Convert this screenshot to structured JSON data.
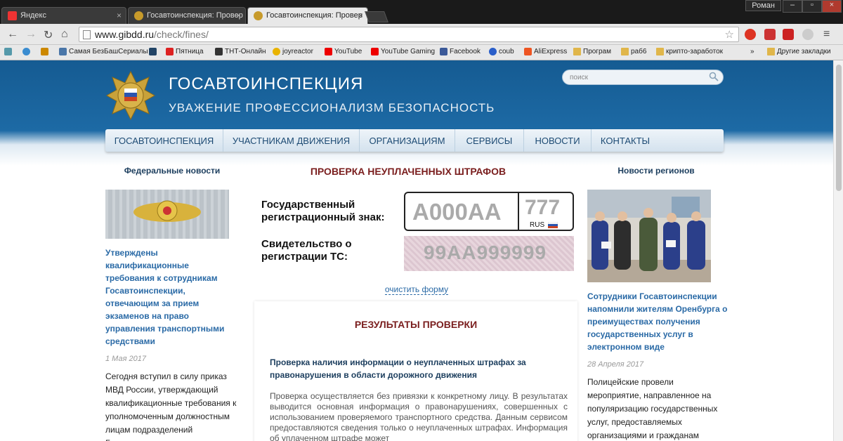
{
  "browser": {
    "tabs": [
      {
        "title": "Яндекс"
      },
      {
        "title": "Госавтоинспекция: Провер"
      },
      {
        "title": "Госавтоинспекция: Провер"
      }
    ],
    "user": "Роман",
    "url_domain": "www.gibdd.ru",
    "url_path": "/check/fines/",
    "bookmarks": [
      {
        "label": "Самая БезБашСериалы"
      },
      {
        "label": "Пятница"
      },
      {
        "label": "ТНТ-Онлайн"
      },
      {
        "label": "joyreactor"
      },
      {
        "label": "YouTube"
      },
      {
        "label": "YouTube Gaming"
      },
      {
        "label": "Facebook"
      },
      {
        "label": "coub"
      },
      {
        "label": "AliExpress"
      },
      {
        "label": "Програм"
      },
      {
        "label": "раб6"
      },
      {
        "label": "крипто-заработок"
      },
      {
        "label": "Другие закладки"
      }
    ],
    "overflow": "»"
  },
  "site": {
    "title": "ГОСАВТОИНСПЕКЦИЯ",
    "motto": "УВАЖЕНИЕ  ПРОФЕССИОНАЛИЗМ  БЕЗОПАСНОСТЬ",
    "search_placeholder": "поиск",
    "nav": [
      "ГОСАВТОИНСПЕКЦИЯ",
      "УЧАСТНИКАМ ДВИЖЕНИЯ",
      "ОРГАНИЗАЦИЯМ",
      "СЕРВИСЫ",
      "НОВОСТИ",
      "КОНТАКТЫ"
    ]
  },
  "left": {
    "heading": "Федеральные новости",
    "news_title": "Утверждены квалификационные требования к сотрудникам Госавтоинспекции, отвечающим за прием экзаменов на право управления транспортными средствами",
    "date": "1 Мая 2017",
    "text": "Сегодня вступил в силу приказ МВД России, утверждающий квалификационные требования к уполномоченным должностным лицам подразделений Госавтоинспекции, на которых в"
  },
  "center": {
    "title": "ПРОВЕРКА НЕУПЛАЧЕННЫХ ШТРАФОВ",
    "plate_label": "Государственный регистрационный знак:",
    "plate_placeholder": "А000АА",
    "region_placeholder": "777",
    "country": "RUS",
    "cert_label": "Свидетельство о регистрации ТС:",
    "cert_placeholder": "99АА999999",
    "clear": "очистить форму",
    "results_title": "РЕЗУЛЬТАТЫ ПРОВЕРКИ",
    "results_heading": "Проверка наличия информации о неуплаченных штрафах за правонарушения в области дорожного движения",
    "results_text": "Проверка осуществляется без привязки к конкретному лицу. В результатах выводится основная информация о правонарушениях, совершенных с использованием проверяемого транспортного средства. Данным сервисом предоставляются сведения только о неуплаченных штрафах. Информация об уплаченном штрафе может"
  },
  "right": {
    "heading": "Новости регионов",
    "news_title": "Сотрудники Госавтоинспекции напомнили жителям Оренбурга о преимуществах получения государственных услуг в электронном виде",
    "date": "28 Апреля 2017",
    "text": "Полицейские провели мероприятие, направленное на популяризацию государственных услуг, предоставляемых организациями и гражданам"
  },
  "colors": {
    "header_blue": "#1d6aa5",
    "link_blue": "#2a6aa6",
    "title_red": "#7a1e1e"
  }
}
